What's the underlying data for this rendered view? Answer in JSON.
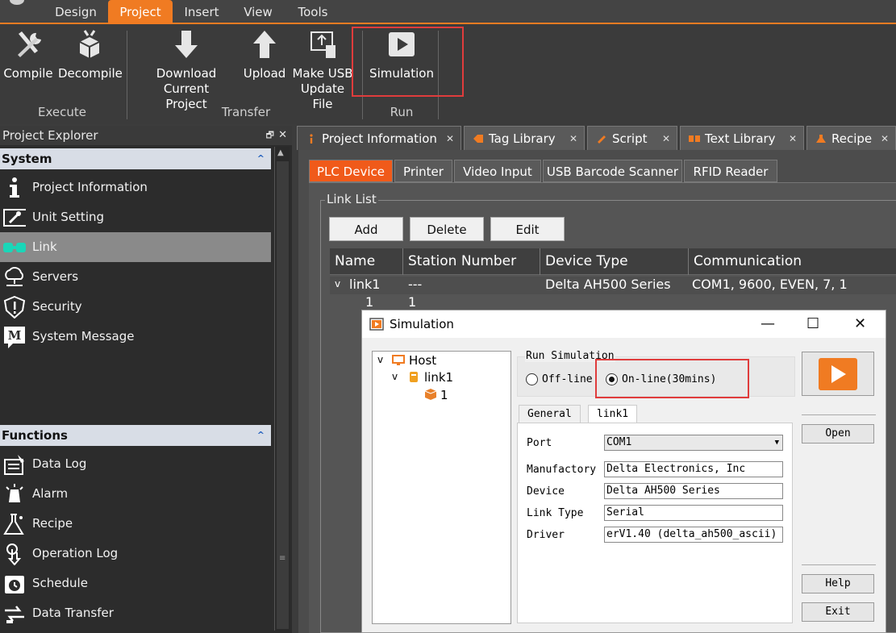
{
  "menu": {
    "tabs": [
      "Design",
      "Project",
      "Insert",
      "View",
      "Tools"
    ],
    "active": "Project"
  },
  "ribbon": {
    "compile": "Compile",
    "decompile": "Decompile",
    "download_line1": "Download Current",
    "download_line2": "Project",
    "upload": "Upload",
    "usb_line1": "Make USB",
    "usb_line2": "Update File",
    "simulation": "Simulation",
    "groups": {
      "execute": "Execute",
      "transfer": "Transfer",
      "run": "Run"
    }
  },
  "explorer": {
    "title": "Project Explorer",
    "pin_glyph": "🗗",
    "close_glyph": "✕",
    "system_header": "System",
    "system_items": [
      {
        "label": "Project Information",
        "icon": "info-icon"
      },
      {
        "label": "Unit Setting",
        "icon": "wrench-icon"
      },
      {
        "label": "Link",
        "icon": "link-icon"
      },
      {
        "label": "Servers",
        "icon": "cloud-icon"
      },
      {
        "label": "Security",
        "icon": "shield-icon"
      },
      {
        "label": "System Message",
        "icon": "message-icon"
      }
    ],
    "functions_header": "Functions",
    "function_items": [
      {
        "label": "Data Log",
        "icon": "datalog-icon"
      },
      {
        "label": "Alarm",
        "icon": "alarm-icon"
      },
      {
        "label": "Recipe",
        "icon": "recipe-icon"
      },
      {
        "label": "Operation Log",
        "icon": "pointer-icon"
      },
      {
        "label": "Schedule",
        "icon": "clock-icon"
      },
      {
        "label": "Data Transfer",
        "icon": "transfer-icon"
      }
    ]
  },
  "doc_tabs": [
    "Project Information",
    "Tag Library",
    "Script",
    "Text Library",
    "Recipe"
  ],
  "device_tabs": [
    "PLC Device",
    "Printer",
    "Video Input",
    "USB Barcode Scanner",
    "RFID Reader"
  ],
  "link_list": {
    "title": "Link List",
    "buttons": [
      "Add",
      "Delete",
      "Edit"
    ],
    "columns": [
      "Name",
      "Station Number",
      "Device Type",
      "Communication"
    ],
    "rows": [
      {
        "name": "link1",
        "station": "---",
        "device": "Delta AH500 Series",
        "comm": "COM1, 9600, EVEN, 7, 1"
      },
      {
        "name": "1",
        "station": "1",
        "device": "",
        "comm": ""
      }
    ]
  },
  "simulation_dialog": {
    "title": "Simulation",
    "minimize": "—",
    "maximize": "☐",
    "close": "✕",
    "tree": {
      "root": "Host",
      "link": "link1",
      "station": "1"
    },
    "run_group": "Run Simulation",
    "offline": "Off-line",
    "online": "On-line(30mins)",
    "tabs": [
      "General",
      "link1"
    ],
    "port_label": "Port",
    "port_value": "COM1",
    "manufactory_label": "Manufactory",
    "manufactory_value": "Delta Electronics, Inc",
    "device_label": "Device",
    "device_value": "Delta AH500 Series",
    "linktype_label": "Link Type",
    "linktype_value": "Serial",
    "driver_label": "Driver",
    "driver_value": "erV1.40 (delta_ah500_ascii)",
    "open": "Open",
    "help": "Help",
    "exit": "Exit"
  },
  "colors": {
    "accent": "#f07b22",
    "highlight": "#e03c3c",
    "active_tab": "#f05a1a"
  }
}
